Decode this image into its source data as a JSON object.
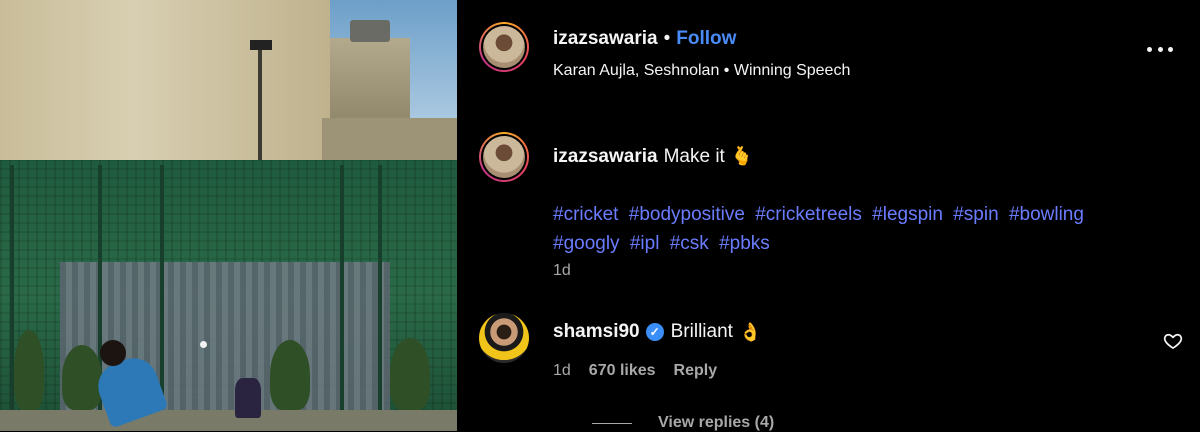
{
  "post": {
    "username": "izazsawaria",
    "separator": "•",
    "follow_label": "Follow",
    "audio": "Karan Aujla, Seshnolan • Winning Speech",
    "more_icon": "more-options-icon"
  },
  "caption": {
    "username": "izazsawaria",
    "text": "Make it",
    "emoji": "🫰",
    "hashtags": [
      "#cricket",
      "#bodypositive",
      "#cricketreels",
      "#legspin",
      "#spin",
      "#bowling",
      "#googly",
      "#ipl",
      "#csk",
      "#pbks"
    ],
    "age": "1d"
  },
  "comments": [
    {
      "username": "shamsi90",
      "verified": true,
      "text": "Brilliant",
      "emoji": "👌",
      "age": "1d",
      "likes": "670 likes",
      "reply_label": "Reply",
      "view_replies": "View replies (4)"
    }
  ],
  "colors": {
    "accent_link": "#4a8cf7",
    "hashtag": "#6b7cff",
    "muted": "#a8a8a8",
    "background": "#000000"
  }
}
